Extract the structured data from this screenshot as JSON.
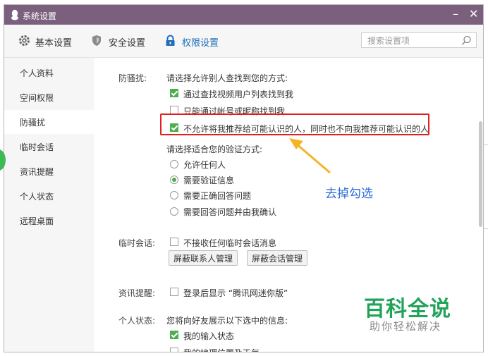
{
  "window": {
    "title": "系统设置",
    "minimize": "–",
    "close": "✕"
  },
  "tabs": [
    {
      "label": "基本设置",
      "icon": "gear-icon"
    },
    {
      "label": "安全设置",
      "icon": "shield-icon"
    },
    {
      "label": "权限设置",
      "icon": "lock-icon",
      "active": true
    }
  ],
  "search": {
    "placeholder": "搜索设置项"
  },
  "sidebar": {
    "items": [
      {
        "label": "个人资料"
      },
      {
        "label": "空间权限"
      },
      {
        "label": "防骚扰",
        "active": true
      },
      {
        "label": "临时会话"
      },
      {
        "label": "资讯提醒"
      },
      {
        "label": "个人状态"
      },
      {
        "label": "远程桌面"
      }
    ]
  },
  "antiharass": {
    "label": "防骚扰:",
    "prompt": "请选择允许别人查找到您的方式:",
    "options": [
      {
        "label": "通过查找视频用户列表找到我",
        "checked": true
      },
      {
        "label": "只能通过帐号或昵称找到我",
        "checked": false
      },
      {
        "label": "不允许将我推荐给可能认识的人，同时也不向我推荐可能认识的人",
        "checked": true
      }
    ],
    "verify_prompt": "请选择适合您的验证方式:",
    "verify_options": [
      {
        "label": "允许任何人",
        "selected": false
      },
      {
        "label": "需要验证信息",
        "selected": true
      },
      {
        "label": "需要正确回答问题",
        "selected": false
      },
      {
        "label": "需要回答问题并由我确认",
        "selected": false
      }
    ]
  },
  "temp_chat": {
    "label": "临时会话:",
    "option": {
      "label": "不接收任何临时会话消息",
      "checked": false
    },
    "btn_contacts": "屏蔽联系人管理",
    "btn_sessions": "屏蔽会话管理"
  },
  "news": {
    "label": "资讯提醒:",
    "option": {
      "label": "登录后显示 “腾讯网迷你版”",
      "checked": false
    }
  },
  "status": {
    "label": "个人状态:",
    "prompt": "您将向好友展示以下选中的信息:",
    "options": [
      {
        "label": "我的输入状态",
        "checked": true
      },
      {
        "label": "我的地理位置及天气",
        "checked": false
      }
    ]
  },
  "annotation": {
    "text": "去掉勾选",
    "color": "#2c6bd6"
  },
  "watermark": {
    "title": "百科全说",
    "subtitle": "助你轻松解决"
  },
  "colors": {
    "titlebar": "#7b607e",
    "accent": "#1f6fb9",
    "check": "#4cae4c",
    "highlight": "#e02020"
  }
}
